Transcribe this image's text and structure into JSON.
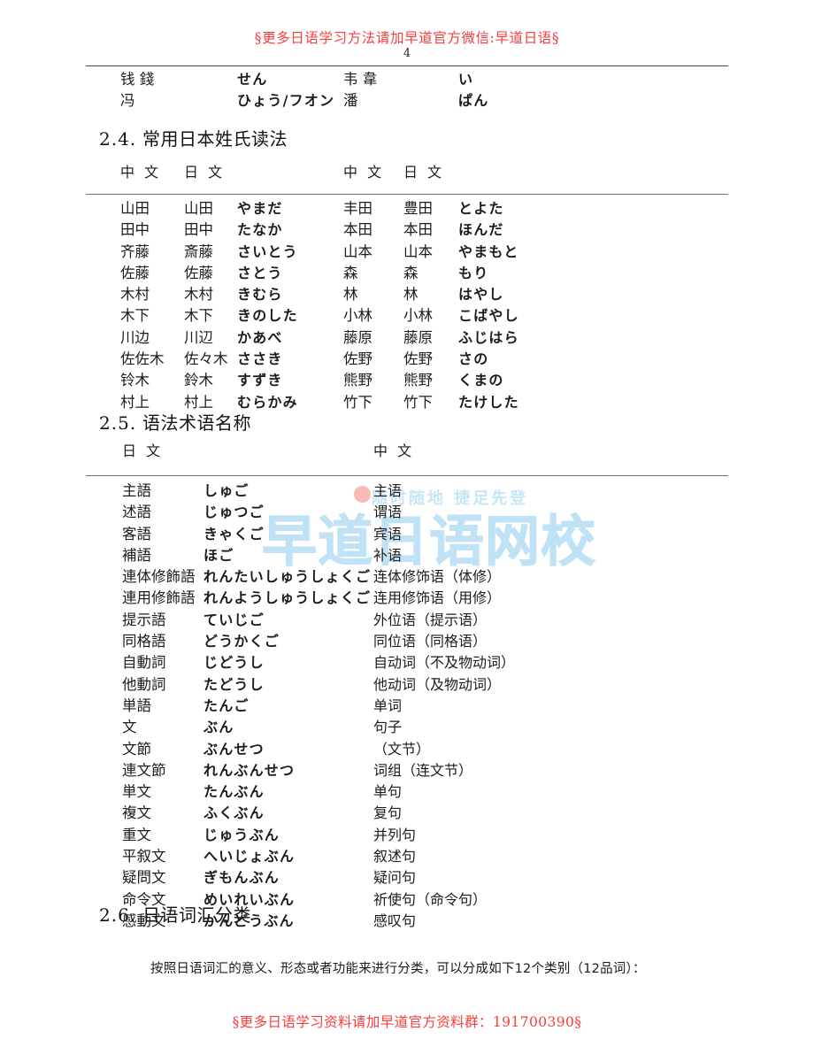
{
  "header": {
    "running_head": "§更多日语学习方法请加早道官方微信:早道日语§",
    "page_number": "4"
  },
  "footer": {
    "running_foot": "§更多日语学习资料请加早道官方资料群：191700390§"
  },
  "watermark": {
    "tagline": "随时随地 捷足先登",
    "brand": "早道日语网校"
  },
  "top_table": {
    "rows": [
      {
        "cn1": "钱 錢",
        "jp1": "",
        "kana1": "せん",
        "cn2": "韦 韋",
        "jp2": "",
        "kana2": "い"
      },
      {
        "cn1": "冯",
        "jp1": "",
        "kana1": "ひょう/フオン",
        "cn2": "潘",
        "jp2": "",
        "kana2": "ぱん"
      }
    ]
  },
  "section_24": {
    "number": "2.4.",
    "title": "常用日本姓氏读法",
    "headers": {
      "left_cn": "中 文",
      "left_jp": "日 文",
      "right_cn": "中 文",
      "right_jp": "日 文"
    },
    "rows": [
      {
        "cn_l": "山田",
        "jp_l": "山田",
        "kana_l": "やまだ",
        "cn_r": "丰田",
        "jp_r": "豊田",
        "kana_r": "とよた"
      },
      {
        "cn_l": "田中",
        "jp_l": "田中",
        "kana_l": "たなか",
        "cn_r": "本田",
        "jp_r": "本田",
        "kana_r": "ほんだ"
      },
      {
        "cn_l": "齐藤",
        "jp_l": "斎藤",
        "kana_l": "さいとう",
        "cn_r": "山本",
        "jp_r": "山本",
        "kana_r": "やまもと"
      },
      {
        "cn_l": "佐藤",
        "jp_l": "佐藤",
        "kana_l": "さとう",
        "cn_r": "森",
        "jp_r": "森",
        "kana_r": "もり"
      },
      {
        "cn_l": "木村",
        "jp_l": "木村",
        "kana_l": "きむら",
        "cn_r": "林",
        "jp_r": "林",
        "kana_r": "はやし"
      },
      {
        "cn_l": "木下",
        "jp_l": "木下",
        "kana_l": "きのした",
        "cn_r": "小林",
        "jp_r": "小林",
        "kana_r": "こばやし"
      },
      {
        "cn_l": "川边",
        "jp_l": "川辺",
        "kana_l": "かあべ",
        "cn_r": "藤原",
        "jp_r": "藤原",
        "kana_r": "ふじはら"
      },
      {
        "cn_l": "佐佐木",
        "jp_l": "佐々木",
        "kana_l": "ささき",
        "cn_r": "佐野",
        "jp_r": "佐野",
        "kana_r": "さの"
      },
      {
        "cn_l": "铃木",
        "jp_l": "鈴木",
        "kana_l": "すずき",
        "cn_r": "熊野",
        "jp_r": "熊野",
        "kana_r": "くまの"
      },
      {
        "cn_l": "村上",
        "jp_l": "村上",
        "kana_l": "むらかみ",
        "cn_r": "竹下",
        "jp_r": "竹下",
        "kana_r": "たけした"
      }
    ]
  },
  "section_25": {
    "number": "2.5.",
    "title": "语法术语名称",
    "headers": {
      "jp": "日 文",
      "cn": "中 文"
    },
    "rows": [
      {
        "jp": "主語",
        "kana": "しゅご",
        "cn": "主语"
      },
      {
        "jp": "述語",
        "kana": "じゅつご",
        "cn": "谓语"
      },
      {
        "jp": "客語",
        "kana": "きゃくご",
        "cn": "宾语"
      },
      {
        "jp": "補語",
        "kana": "ほご",
        "cn": "补语"
      },
      {
        "jp": "連体修飾語",
        "kana": "れんたいしゅうしょくご",
        "cn": "连体修饰语（体修）"
      },
      {
        "jp": "連用修飾語",
        "kana": "れんようしゅうしょくご",
        "cn": "连用修饰语（用修）"
      },
      {
        "jp": "提示語",
        "kana": "ていじご",
        "cn": "外位语（提示语）"
      },
      {
        "jp": "同格語",
        "kana": "どうかくご",
        "cn": "同位语（同格语）"
      },
      {
        "jp": "自動詞",
        "kana": "じどうし",
        "cn": "自动词（不及物动词）"
      },
      {
        "jp": "他動詞",
        "kana": "たどうし",
        "cn": "他动词（及物动词）"
      },
      {
        "jp": "単語",
        "kana": "たんご",
        "cn": "单词"
      },
      {
        "jp": "文",
        "kana": "ぶん",
        "cn": "句子"
      },
      {
        "jp": "文節",
        "kana": "ぶんせつ",
        "cn": "（文节）"
      },
      {
        "jp": "連文節",
        "kana": "れんぶんせつ",
        "cn": "词组（连文节）"
      },
      {
        "jp": "単文",
        "kana": "たんぶん",
        "cn": "单句"
      },
      {
        "jp": "複文",
        "kana": "ふくぶん",
        "cn": "复句"
      },
      {
        "jp": "重文",
        "kana": "じゅうぶん",
        "cn": "并列句"
      },
      {
        "jp": "平叙文",
        "kana": "へいじょぶん",
        "cn": "叙述句"
      },
      {
        "jp": "疑問文",
        "kana": "ぎもんぶん",
        "cn": "疑问句"
      },
      {
        "jp": "命令文",
        "kana": "めいれいぶん",
        "cn": "祈使句（命令句）"
      },
      {
        "jp": "感動文",
        "kana": "かんどうぶん",
        "cn": "感叹句"
      }
    ]
  },
  "section_26": {
    "number": "2.6.",
    "title": "日语词汇分类",
    "paragraph": "按照日语词汇的意义、形态或者功能来进行分类，可以分成如下12个类别（12品词）："
  }
}
